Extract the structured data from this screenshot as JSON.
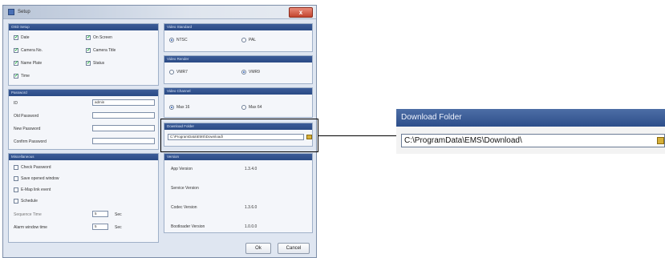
{
  "window": {
    "title": "Setup",
    "close_label": "x"
  },
  "osd_setup": {
    "title": "OSD Setup",
    "items": [
      {
        "label": "Date",
        "checked": true
      },
      {
        "label": "On Screen",
        "checked": true
      },
      {
        "label": "Camera No.",
        "checked": true
      },
      {
        "label": "Camera Title",
        "checked": true
      },
      {
        "label": "Name Plate",
        "checked": true
      },
      {
        "label": "Status",
        "checked": true
      },
      {
        "label": "Time",
        "checked": true
      }
    ]
  },
  "video_standard": {
    "title": "Video Standard",
    "options": [
      "NTSC",
      "PAL"
    ],
    "selected": "NTSC"
  },
  "video_render": {
    "title": "Video Render",
    "options": [
      "VMR7",
      "VMR9"
    ],
    "selected": "VMR9"
  },
  "video_channel": {
    "title": "Video Channel",
    "options": [
      "Max 16",
      "Max 64"
    ],
    "selected": "Max 16"
  },
  "password": {
    "title": "Password",
    "id_label": "ID",
    "id_value": "admin",
    "old_label": "Old Password",
    "new_label": "New Password",
    "confirm_label": "Confirm Password"
  },
  "download_folder": {
    "title": "Download Folder",
    "path": "C:\\ProgramData\\EMS\\Download\\"
  },
  "miscellaneous": {
    "title": "Miscellaneous",
    "items": [
      {
        "label": "Check Password",
        "checked": false
      },
      {
        "label": "Save opened window",
        "checked": false
      },
      {
        "label": "E-Map link event",
        "checked": false
      },
      {
        "label": "Schedule",
        "checked": false
      }
    ],
    "sequence_label": "Sequence Time",
    "sequence_value": "5",
    "sequence_unit": "Sec",
    "alarm_label": "Alarm window time",
    "alarm_value": "5",
    "alarm_unit": "Sec"
  },
  "version": {
    "title": "Version",
    "rows": [
      {
        "label": "App Version",
        "value": "1.3.4.0"
      },
      {
        "label": "Service Version",
        "value": ""
      },
      {
        "label": "Codec Version",
        "value": "1.3.6.0"
      },
      {
        "label": "Bootloader Version",
        "value": "1.0.0.0"
      }
    ]
  },
  "buttons": {
    "ok": "Ok",
    "cancel": "Cancel"
  },
  "zoom": {
    "title": "Download Folder",
    "path": "C:\\ProgramData\\EMS\\Download\\"
  },
  "colors": {
    "header": "#2d4e8a",
    "window_bg": "#dfe6f1",
    "accent": "#000000"
  }
}
